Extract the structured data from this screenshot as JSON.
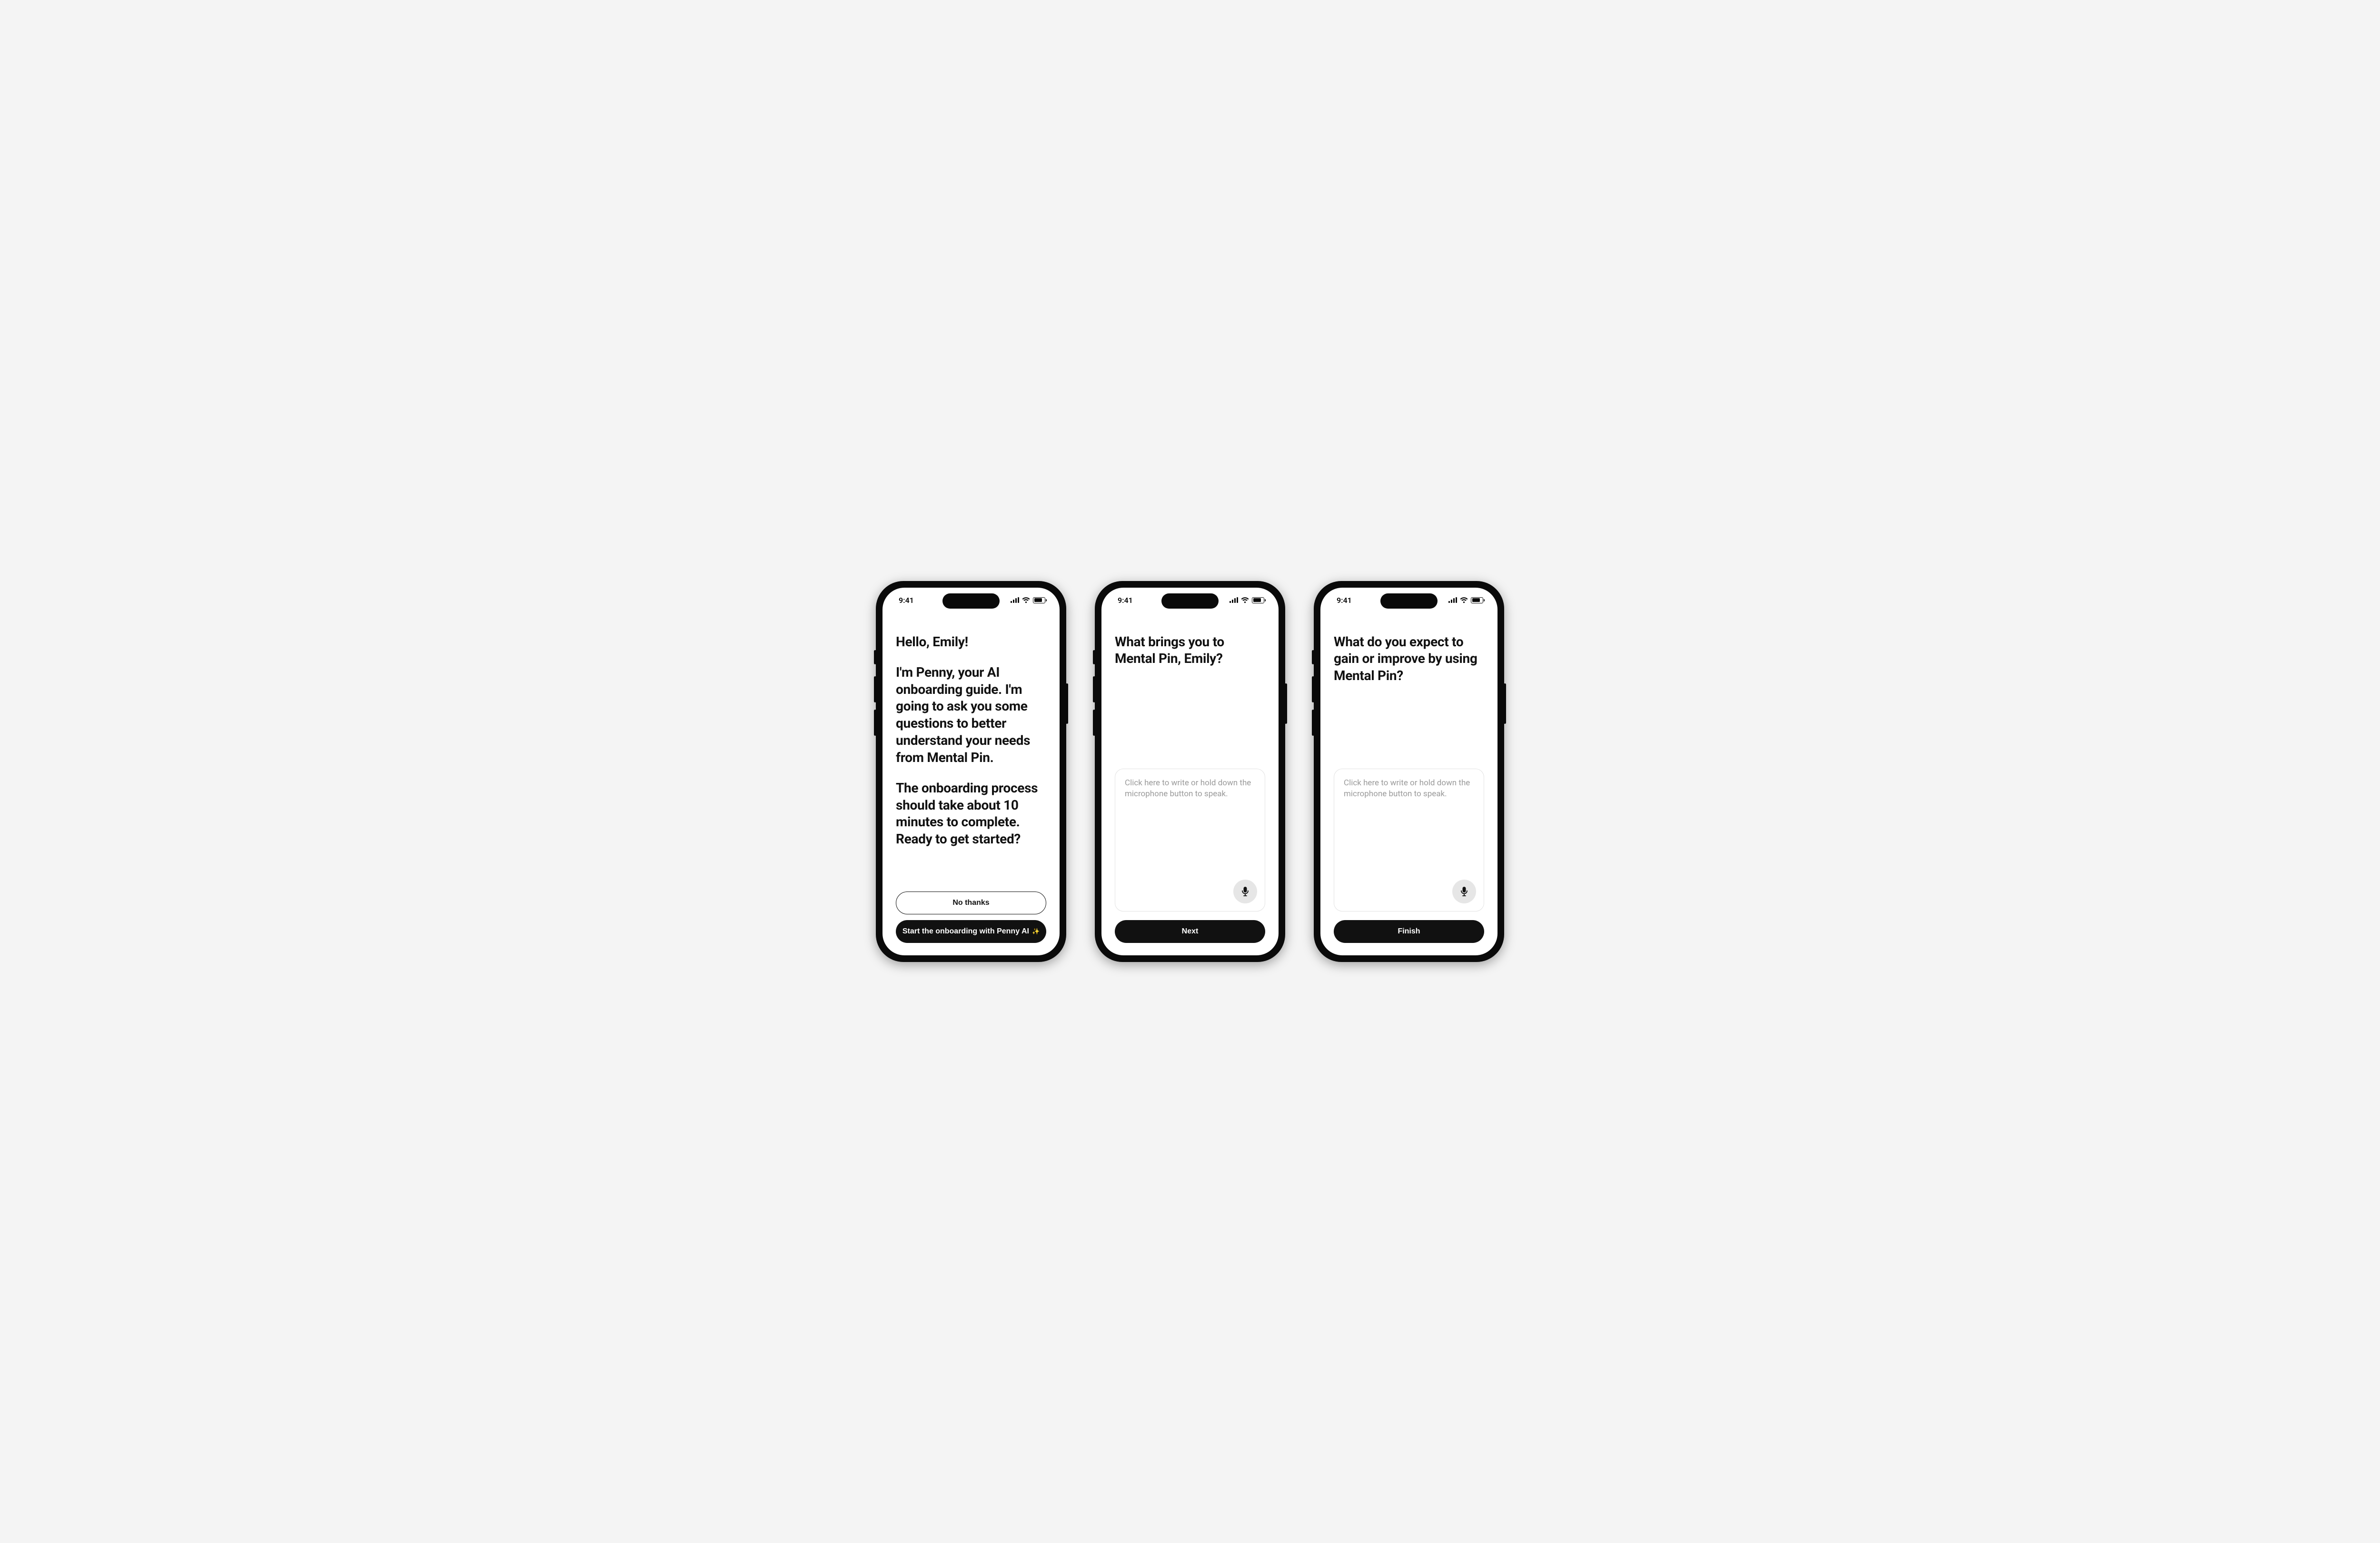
{
  "status": {
    "time": "9:41"
  },
  "screens": [
    {
      "intro": {
        "greeting": "Hello, Emily!",
        "body": "I'm Penny, your AI onboarding guide. I'm going to ask you some questions to better understand your needs from Mental Pin.",
        "timing": "The onboarding process should take about 10 minutes to complete. Ready to get started?"
      },
      "buttons": {
        "decline": "No thanks",
        "start": "Start the onboarding with Penny AI"
      }
    },
    {
      "question": "What brings you to Mental Pin, Emily?",
      "placeholder": "Click here to write or hold down the microphone button to speak.",
      "cta": "Next"
    },
    {
      "question": "What do you expect to gain or improve by using Mental Pin?",
      "placeholder": "Click here to write or hold down the microphone button to speak.",
      "cta": "Finish"
    }
  ]
}
